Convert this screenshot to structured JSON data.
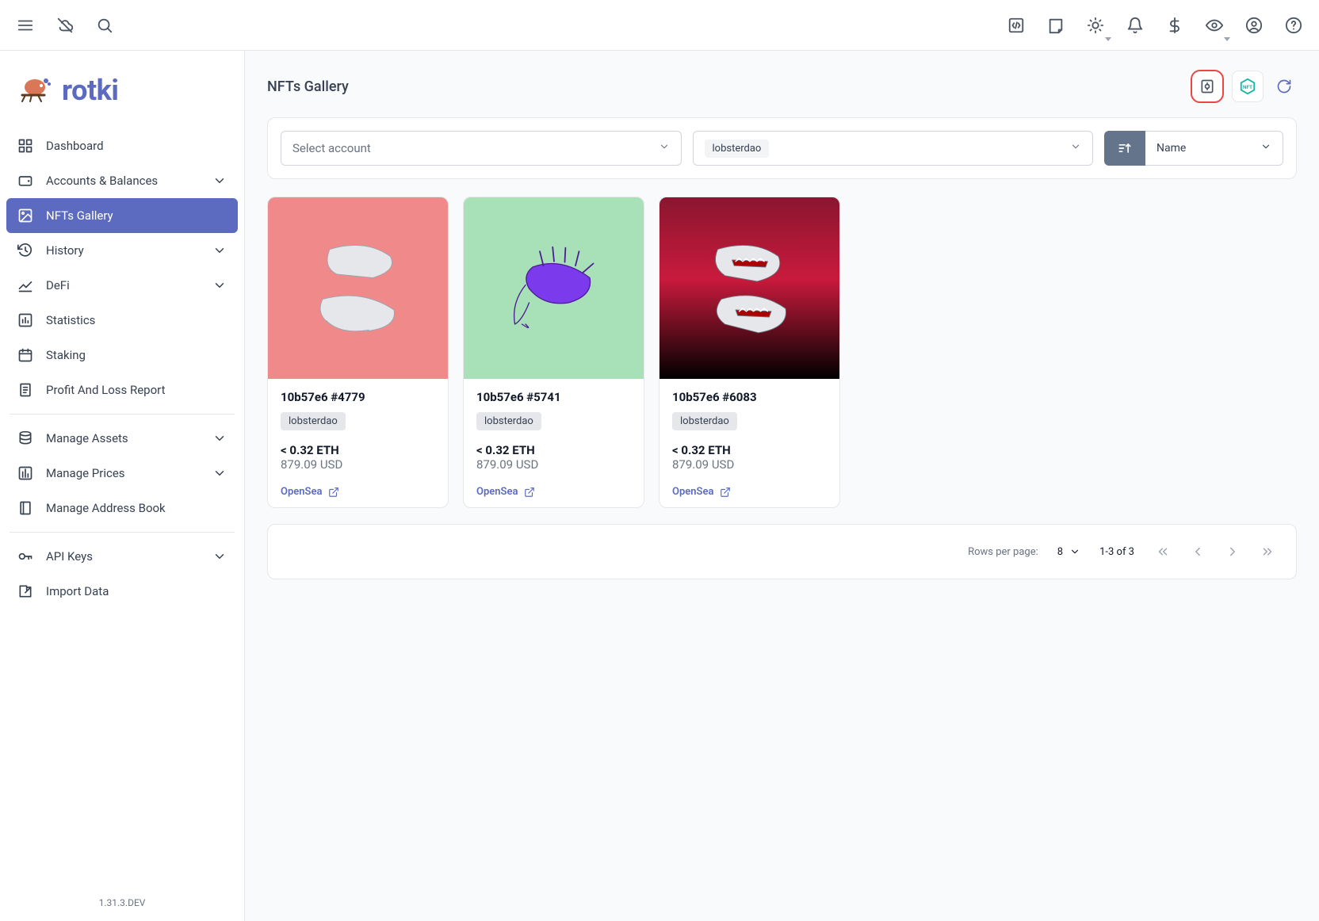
{
  "brand": {
    "name": "rotki"
  },
  "sidebar": {
    "items": [
      {
        "label": "Dashboard",
        "icon": "dashboard"
      },
      {
        "label": "Accounts & Balances",
        "icon": "wallet",
        "expandable": true
      },
      {
        "label": "NFTs Gallery",
        "icon": "image",
        "active": true
      },
      {
        "label": "History",
        "icon": "history",
        "expandable": true
      },
      {
        "label": "DeFi",
        "icon": "chart-line",
        "expandable": true
      },
      {
        "label": "Statistics",
        "icon": "bar-chart"
      },
      {
        "label": "Staking",
        "icon": "calendar"
      },
      {
        "label": "Profit And Loss Report",
        "icon": "receipt"
      }
    ],
    "manage": [
      {
        "label": "Manage Assets",
        "icon": "database",
        "expandable": true
      },
      {
        "label": "Manage Prices",
        "icon": "prices",
        "expandable": true
      },
      {
        "label": "Manage Address Book",
        "icon": "book"
      }
    ],
    "bottom": [
      {
        "label": "API Keys",
        "icon": "key",
        "expandable": true
      },
      {
        "label": "Import Data",
        "icon": "import"
      }
    ],
    "version": "1.31.3.DEV"
  },
  "page": {
    "title": "NFTs Gallery",
    "account_select_placeholder": "Select account",
    "collection_filter": "lobsterdao",
    "sort_by": "Name"
  },
  "nfts": [
    {
      "title": "10b57e6 #4779",
      "collection": "lobsterdao",
      "price_crypto": "< 0.32 ETH",
      "price_fiat": "879.09 USD",
      "marketplace": "OpenSea",
      "bg": "c0"
    },
    {
      "title": "10b57e6 #5741",
      "collection": "lobsterdao",
      "price_crypto": "< 0.32 ETH",
      "price_fiat": "879.09 USD",
      "marketplace": "OpenSea",
      "bg": "c1"
    },
    {
      "title": "10b57e6 #6083",
      "collection": "lobsterdao",
      "price_crypto": "< 0.32 ETH",
      "price_fiat": "879.09 USD",
      "marketplace": "OpenSea",
      "bg": "c2"
    }
  ],
  "pagination": {
    "rows_label": "Rows per page:",
    "rows_value": "8",
    "range": "1-3 of 3"
  }
}
